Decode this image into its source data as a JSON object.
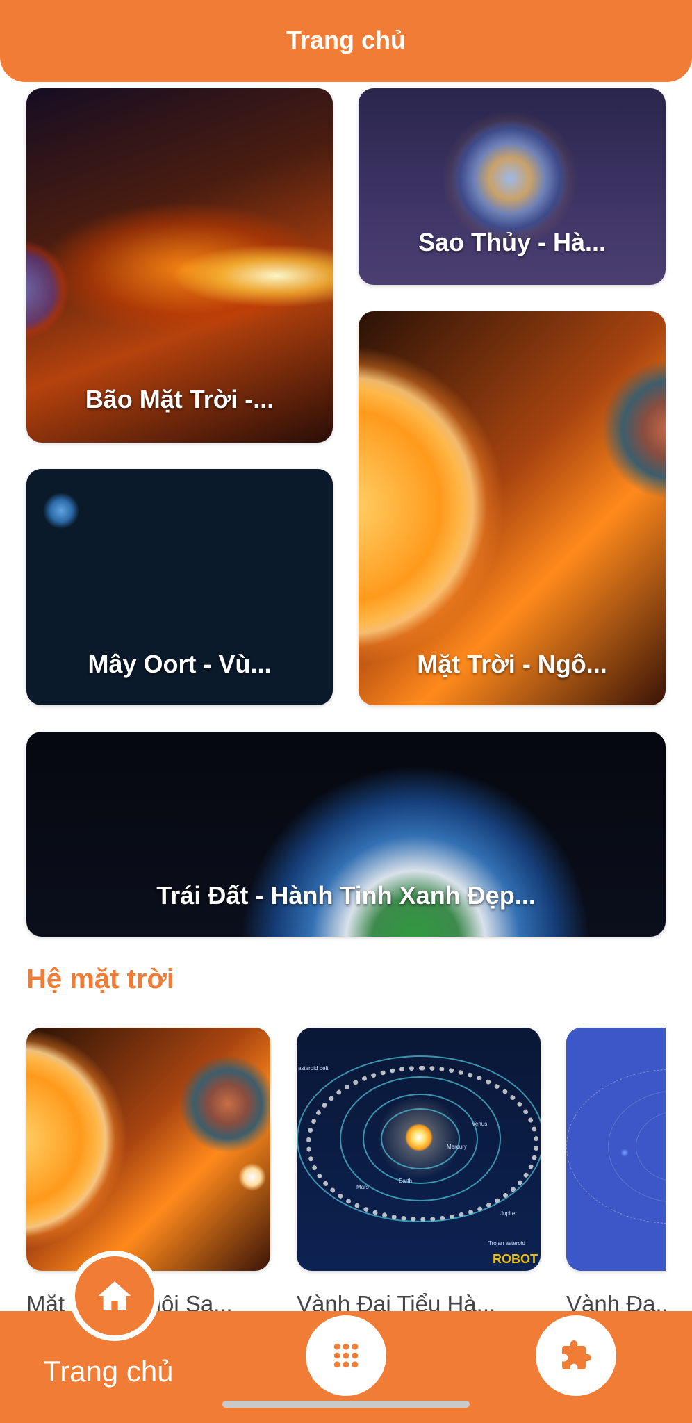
{
  "header": {
    "title": "Trang chủ"
  },
  "featured": [
    {
      "title": "Bão Mặt Trời -..."
    },
    {
      "title": "Sao Thủy - Hà..."
    },
    {
      "title": "Mặt Trời - Ngô..."
    },
    {
      "title": "Mây Oort - Vù..."
    },
    {
      "title": "Trái Đất - Hành Tinh Xanh Đẹp..."
    }
  ],
  "section": {
    "title": "Hệ mặt trời"
  },
  "solar_system_cards": [
    {
      "label": "Mặt Trời - Ngôi Sa..."
    },
    {
      "label": "Vành Đai Tiểu Hà...",
      "image_text": {
        "belt": "asteroid belt",
        "venus": "Venus",
        "mercury": "Mercury",
        "mars": "Mars",
        "earth": "Earth",
        "jupiter": "Jupiter",
        "trojan": "Trojan asteroid",
        "watermark": "ROBOT"
      }
    },
    {
      "label": "Vành Đa..."
    }
  ],
  "nav": {
    "home_label": "Trang chủ",
    "home_icon": "home-icon",
    "grid_icon": "grid-icon",
    "puzzle_icon": "puzzle-icon"
  },
  "colors": {
    "accent": "#F07C35"
  }
}
